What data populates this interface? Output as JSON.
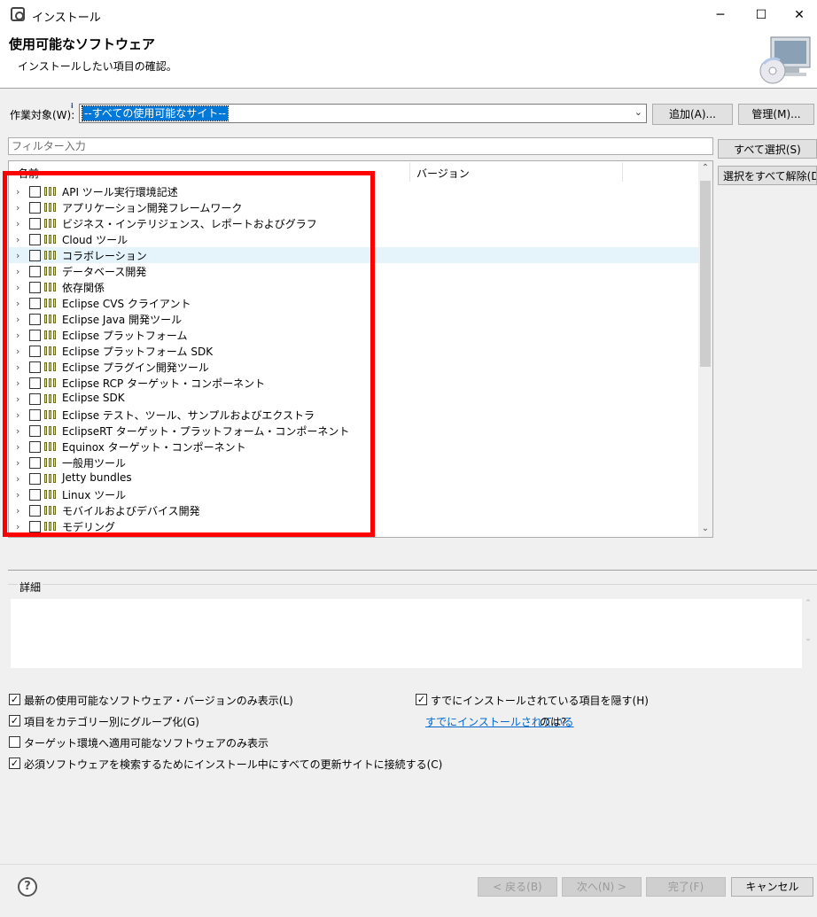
{
  "window": {
    "title": "インストール",
    "minimize": "─",
    "maximize": "☐",
    "close": "✕"
  },
  "header": {
    "title": "使用可能なソフトウェア",
    "subtitle": "インストールしたい項目の確認。",
    "icon": "monitor-cd-icon"
  },
  "workwith": {
    "label": "作業対象(W):",
    "value": "--すべての使用可能なサイト--",
    "add_label": "追加(A)...",
    "manage_label": "管理(M)..."
  },
  "filter": {
    "placeholder": "フィルター入力",
    "select_all": "すべて選択(S)",
    "deselect_all": "選択をすべて解除(D)"
  },
  "tree": {
    "columns": [
      "名前",
      "バージョン"
    ],
    "highlighted_index": 4,
    "items": [
      "API ツール実行環境記述",
      "アプリケーション開発フレームワーク",
      "ビジネス・インテリジェンス、レポートおよびグラフ",
      "Cloud ツール",
      "コラボレーション",
      "データベース開発",
      "依存関係",
      "Eclipse CVS クライアント",
      "Eclipse Java 開発ツール",
      "Eclipse プラットフォーム",
      "Eclipse プラットフォーム SDK",
      "Eclipse プラグイン開発ツール",
      "Eclipse RCP ターゲット・コンポーネント",
      "Eclipse SDK",
      "Eclipse テスト、ツール、サンプルおよびエクストラ",
      "EclipseRT ターゲット・プラットフォーム・コンポーネント",
      "Equinox ターゲット・コンポーネント",
      "一般用ツール",
      "Jetty bundles",
      "Linux ツール",
      "モバイルおよびデバイス開発",
      "モデリング"
    ]
  },
  "details": {
    "label": "詳細"
  },
  "options": {
    "latest_only": {
      "label": "最新の使用可能なソフトウェア・バージョンのみ表示(L)",
      "checked": true
    },
    "group_by_category": {
      "label": "項目をカテゴリー別にグループ化(G)",
      "checked": true
    },
    "target_only": {
      "label": "ターゲット環境へ適用可能なソフトウェアのみ表示",
      "checked": false
    },
    "contact_all": {
      "label": "必須ソフトウェアを検索するためにインストール中にすべての更新サイトに接続する(C)",
      "checked": true
    },
    "hide_installed": {
      "label": "すでにインストールされている項目を隠す(H)",
      "checked": true
    },
    "installed_link": "すでにインストールされている",
    "installed_suffix": "のは?"
  },
  "footer": {
    "help": "?",
    "back": "< 戻る(B)",
    "next": "次へ(N) >",
    "finish": "完了(F)",
    "cancel": "キャンセル"
  },
  "colors": {
    "highlight_box": "#ff0000",
    "selection": "#0078d7",
    "link": "#0066cc"
  }
}
